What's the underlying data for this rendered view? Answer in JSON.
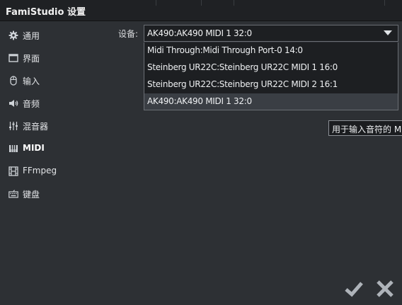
{
  "window": {
    "title": "FamiStudio 设置"
  },
  "sidebar": {
    "items": [
      {
        "label": "通用",
        "icon": "gear-icon"
      },
      {
        "label": "界面",
        "icon": "window-icon"
      },
      {
        "label": "输入",
        "icon": "mouse-icon"
      },
      {
        "label": "音频",
        "icon": "speaker-icon"
      },
      {
        "label": "混音器",
        "icon": "mixer-icon"
      },
      {
        "label": "MIDI",
        "icon": "piano-icon"
      },
      {
        "label": "FFmpeg",
        "icon": "film-icon"
      },
      {
        "label": "键盘",
        "icon": "keyboard-icon"
      }
    ],
    "active_index": 5
  },
  "midi": {
    "device_label": "设备:",
    "selected_device": "AK490:AK490 MIDI 1 32:0",
    "options": [
      "Midi Through:Midi Through Port-0 14:0",
      "Steinberg UR22C:Steinberg UR22C MIDI 1 16:0",
      "Steinberg UR22C:Steinberg UR22C MIDI 2 16:1",
      "AK490:AK490 MIDI 1 32:0"
    ],
    "tooltip": "用于输入音符的 M"
  },
  "actions": {
    "ok_icon": "checkmark-icon",
    "cancel_icon": "close-icon"
  }
}
